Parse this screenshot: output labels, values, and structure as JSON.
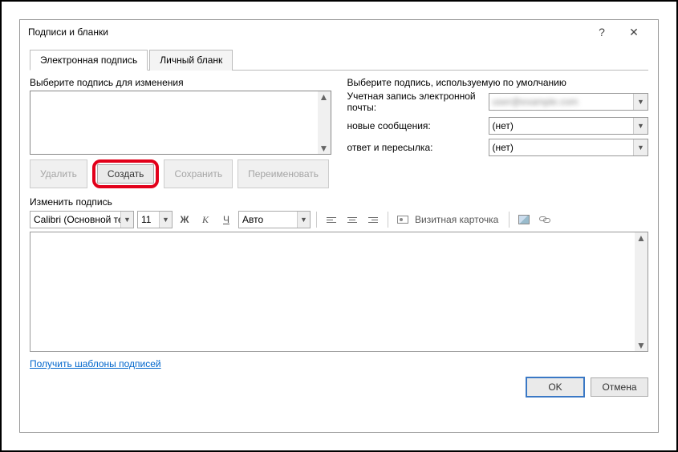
{
  "window": {
    "title": "Подписи и бланки",
    "help": "?",
    "close": "✕"
  },
  "tabs": {
    "t0": "Электронная подпись",
    "t1": "Личный бланк"
  },
  "left": {
    "label": "Выберите подпись для изменения",
    "btn_delete": "Удалить",
    "btn_create": "Создать",
    "btn_save": "Сохранить",
    "btn_rename": "Переименовать"
  },
  "right": {
    "label": "Выберите подпись, используемую по умолчанию",
    "row_account": "Учетная запись электронной почты:",
    "row_new": "новые сообщения:",
    "row_reply": "ответ и пересылка:",
    "account_value": "user@example.com",
    "none": "(нет)"
  },
  "edit": {
    "label": "Изменить подпись",
    "font": "Calibri (Основной те",
    "size": "11",
    "auto": "Авто",
    "bold": "Ж",
    "italic": "К",
    "underline": "Ч",
    "card": "Визитная карточка"
  },
  "link": "Получить шаблоны подписей",
  "footer": {
    "ok": "OK",
    "cancel": "Отмена"
  }
}
